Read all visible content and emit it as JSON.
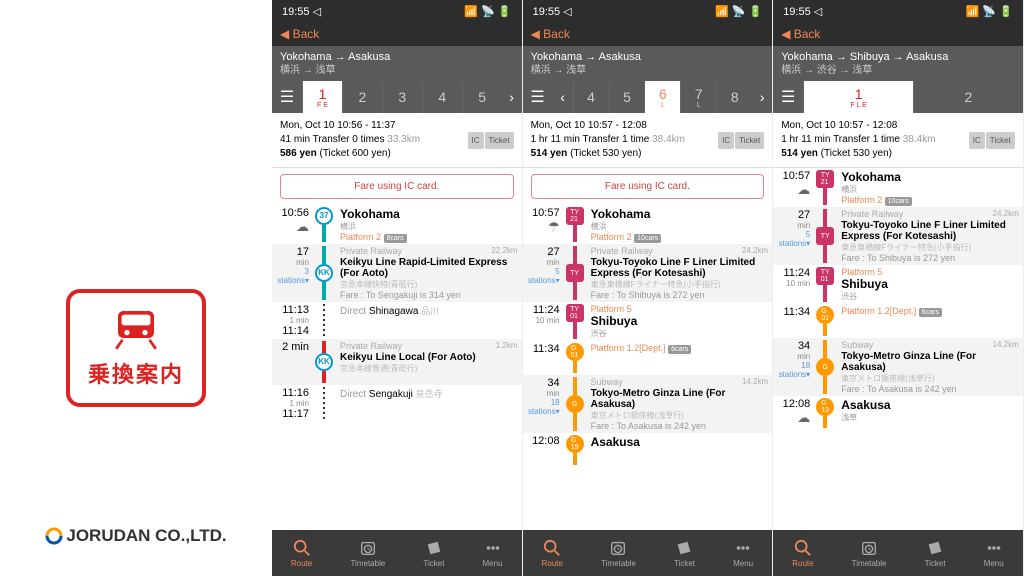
{
  "app": {
    "logo_jp": "乗換案内",
    "company": "JORUDAN CO.,LTD."
  },
  "status": {
    "time": "19:55",
    "loc": "◁"
  },
  "nav": {
    "back": "Back",
    "chev": "◀"
  },
  "screens": [
    {
      "route": {
        "en": "Yokohama → Asakusa",
        "jp": "横浜 → 浅草"
      },
      "tabs": {
        "mode": "right",
        "items": [
          "1",
          "2",
          "3",
          "4",
          "5"
        ],
        "activeIdx": 0,
        "activeColor": "red",
        "subs": [
          "F   E",
          "",
          "",
          "",
          ""
        ]
      },
      "summary": {
        "l1": "Mon, Oct 10 10:56 - 11:37",
        "l2a": "41 min Transfer 0 times ",
        "l2b": "33.3km",
        "l3": "586 yen  (Ticket 600 yen)",
        "ic": "IC",
        "tk": "Ticket"
      },
      "notice": "Fare using IC card.",
      "rows": [
        {
          "type": "station",
          "time": "10:56",
          "weather": "☁",
          "badge": {
            "cls": "kk",
            "t": "37"
          },
          "lineCls": "teal",
          "name": "Yokohama",
          "jp": "横浜",
          "platform": "Platform 2",
          "cars": "8cars"
        },
        {
          "type": "segment",
          "timeTop": "17",
          "timeSub": "min",
          "badge": {
            "cls": "kk",
            "t": "KK"
          },
          "lineCls": "teal",
          "priv": "Private Railway",
          "dist": "22.2km",
          "line": "Keikyu Line Rapid-Limited Express (For Aoto)",
          "linejp": "京急本線快特(青砥行)",
          "stations": "3 stations▾",
          "fare": "Fare : To Sengakuji is 314 yen"
        },
        {
          "type": "mid",
          "time": "11:13",
          "sub": "1 min",
          "time2": "11:14",
          "lineCls": "dots",
          "direct": "Direct",
          "dval": "Shinagawa",
          "djp": "品川"
        },
        {
          "type": "segment",
          "timeTop": "2 min",
          "badge": {
            "cls": "kk",
            "t": "KK"
          },
          "lineCls": "red",
          "priv": "Private Railway",
          "dist": "1.2km",
          "line": "Keikyu Line Local (For Aoto)",
          "linejp": "京急本線普通(青砥行)"
        },
        {
          "type": "mid",
          "time": "11:16",
          "sub": "1 min",
          "time2": "11:17",
          "lineCls": "dots",
          "direct": "Direct",
          "dval": "Sengakuji",
          "djp": "泉岳寺"
        }
      ]
    },
    {
      "route": {
        "en": "Yokohama → Asakusa",
        "jp": "横浜 → 浅草"
      },
      "tabs": {
        "mode": "both",
        "items": [
          "4",
          "5",
          "6",
          "7",
          "8"
        ],
        "activeIdx": 2,
        "activeColor": "orange",
        "subs": [
          "",
          "",
          "L",
          "L",
          ""
        ]
      },
      "summary": {
        "l1": "Mon, Oct 10 10:57 - 12:08",
        "l2a": "1 hr 11 min Transfer 1 time ",
        "l2b": "38.4km",
        "l3": "514 yen  (Ticket 530 yen)",
        "ic": "IC",
        "tk": "Ticket"
      },
      "notice": "Fare using IC card.",
      "rows": [
        {
          "type": "station",
          "time": "10:57",
          "weather": "☂",
          "badge": {
            "cls": "ty",
            "t": "TY 21"
          },
          "lineCls": "pink",
          "name": "Yokohama",
          "jp": "横浜",
          "platform": "Platform 2",
          "cars": "10cars"
        },
        {
          "type": "segment",
          "timeTop": "27",
          "timeSub": "min",
          "badge": {
            "cls": "ty",
            "t": "TY"
          },
          "lineCls": "pink",
          "priv": "Private Railway",
          "dist": "24.2km",
          "line": "Tokyu-Toyoko Line F Liner Limited Express (For Kotesashi)",
          "linejp": "東急東横線Fライナー特急(小手指行)",
          "stations": "5 stations▾",
          "fare": "Fare : To Shibuya is 272 yen"
        },
        {
          "type": "station",
          "time": "11:24",
          "sub": "10 min",
          "badge": {
            "cls": "ty",
            "t": "TY 01"
          },
          "lineCls": "pink",
          "platformTop": "Platform 5",
          "name": "Shibuya",
          "jp": "渋谷"
        },
        {
          "type": "station",
          "time": "11:34",
          "badge": {
            "cls": "g",
            "t": "G 01"
          },
          "lineCls": "orange",
          "platform": "Platform 1.2[Dept.]",
          "cars": "6cars"
        },
        {
          "type": "segment",
          "timeTop": "34",
          "timeSub": "min",
          "badge": {
            "cls": "g",
            "t": "G"
          },
          "lineCls": "orange",
          "priv": "Subway",
          "dist": "14.2km",
          "line": "Tokyo-Metro Ginza Line (For Asakusa)",
          "linejp": "東京メトロ銀座線(浅草行)",
          "stations": "18 stations▾",
          "fare": "Fare : To Asakusa is 242 yen"
        },
        {
          "type": "station",
          "time": "12:08",
          "badge": {
            "cls": "g",
            "t": "G 19"
          },
          "lineCls": "orange",
          "name": "Asakusa"
        }
      ]
    },
    {
      "route": {
        "en": "Yokohama → Shibuya → Asakusa",
        "jp": "横浜 → 渋谷 → 浅草"
      },
      "tabs": {
        "mode": "none",
        "items": [
          "1",
          "2"
        ],
        "activeIdx": 0,
        "activeColor": "red",
        "subs": [
          "F L E",
          ""
        ]
      },
      "summary": {
        "l1": "Mon, Oct 10 10:57 - 12:08",
        "l2a": "1 hr 11 min Transfer 1 time ",
        "l2b": "38.4km",
        "l3": "514 yen  (Ticket 530 yen)",
        "ic": "IC",
        "tk": "Ticket"
      },
      "rows": [
        {
          "type": "station",
          "time": "10:57",
          "weather": "☁",
          "badge": {
            "cls": "ty",
            "t": "TY 21"
          },
          "lineCls": "pink",
          "name": "Yokohama",
          "jp": "横浜",
          "platform": "Platform 2",
          "cars": "10cars"
        },
        {
          "type": "segment",
          "timeTop": "27",
          "timeSub": "min",
          "badge": {
            "cls": "ty",
            "t": "TY"
          },
          "lineCls": "pink",
          "priv": "Private Railway",
          "dist": "24.2km",
          "line": "Tokyu-Toyoko Line F Liner Limited Express (For Kotesashi)",
          "linejp": "東急東横線Fライナー特急(小手指行)",
          "stations": "5 stations▾",
          "fare": "Fare : To Shibuya is 272 yen"
        },
        {
          "type": "station",
          "time": "11:24",
          "sub": "10 min",
          "badge": {
            "cls": "ty",
            "t": "TY 01"
          },
          "lineCls": "pink",
          "platformTop": "Platform 5",
          "name": "Shibuya",
          "jp": "渋谷"
        },
        {
          "type": "station",
          "time": "11:34",
          "badge": {
            "cls": "g",
            "t": "G 01"
          },
          "lineCls": "orange",
          "platform": "Platform 1.2[Dept.]",
          "cars": "6cars"
        },
        {
          "type": "segment",
          "timeTop": "34",
          "timeSub": "min",
          "badge": {
            "cls": "g",
            "t": "G"
          },
          "lineCls": "orange",
          "priv": "Subway",
          "dist": "14.2km",
          "line": "Tokyo-Metro Ginza Line (For Asakusa)",
          "linejp": "東京メトロ銀座線(浅草行)",
          "stations": "18 stations▾",
          "fare": "Fare : To Asakusa is 242 yen"
        },
        {
          "type": "station",
          "time": "12:08",
          "weather": "☁",
          "badge": {
            "cls": "g",
            "t": "G 19"
          },
          "lineCls": "orange",
          "name": "Asakusa",
          "jp": "浅草"
        }
      ]
    }
  ],
  "bottomNav": [
    {
      "label": "Route",
      "active": true,
      "icon": "search"
    },
    {
      "label": "Timetable",
      "active": false,
      "icon": "clock"
    },
    {
      "label": "Ticket",
      "active": false,
      "icon": "ticket"
    },
    {
      "label": "Menu",
      "active": false,
      "icon": "dots"
    }
  ]
}
